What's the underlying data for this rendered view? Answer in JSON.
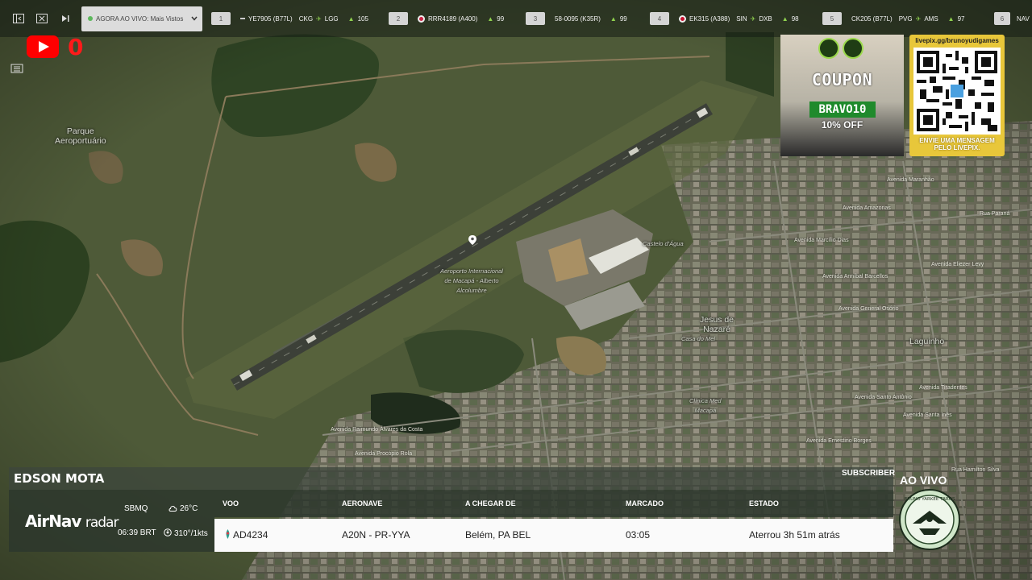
{
  "toolbar": {
    "live_selector": "AGORA AO VIVO: Mais Vistos",
    "flights": [
      {
        "num": "1",
        "callsign": "YE7905 (B77L)",
        "from": "CKG",
        "to": "LGG",
        "pax": "105"
      },
      {
        "num": "2",
        "callsign": "RRR4189 (A400)",
        "from": "",
        "to": "",
        "pax": "99"
      },
      {
        "num": "3",
        "callsign": "58-0095 (K35R)",
        "from": "",
        "to": "",
        "pax": "99"
      },
      {
        "num": "4",
        "callsign": "EK315 (A388)",
        "from": "SIN",
        "to": "DXB",
        "pax": "98"
      },
      {
        "num": "5",
        "callsign": "CK205 (B77L)",
        "from": "PVG",
        "to": "AMS",
        "pax": "97"
      },
      {
        "num": "6",
        "callsign": "NAV",
        "from": "",
        "to": "",
        "pax": ""
      }
    ]
  },
  "overlay": {
    "viewer_count": "0"
  },
  "map": {
    "labels": {
      "park": "Parque\nAeroportuário",
      "airport": "Aeroporto Internacional\nde Macapá - Alberto\nAlcolumbre",
      "water_tower": "Castelo d'Água",
      "nazare": "Jesus de\nNazaré",
      "laguinho": "Laguinho",
      "casa": "Casa do Mel",
      "clinic": "Clínica Med\nMacapá",
      "streets": [
        "Avenida Raimundo Álvares da Costa",
        "Avenida Procópio Rola",
        "Avenida Marcílio Dias",
        "Avenida Anníbal Barcellos",
        "Avenida General Osório",
        "Avenida Santo Antônio",
        "Avenida Ernestino Borges",
        "Avenida Eliezer Levy",
        "Avenida Tiradentes",
        "Rua Paraná",
        "Avenida Maranhão",
        "Avenida Amazonas",
        "Avenida Santa Inês",
        "Rua Hamilton Silva"
      ]
    }
  },
  "ads": {
    "coupon": {
      "brand": "",
      "title": "COUPON",
      "subtitle": "",
      "code": "BRAVO10",
      "discount": "10% OFF",
      "fine": "",
      "footer": ""
    },
    "qr": {
      "url": "livepix.gg/brunoyudigames",
      "message": "ENVIE UMA MENSAGEM\nPELO LIVEPIX."
    }
  },
  "panel": {
    "streamer": "EDSON MOTA",
    "brand_main": "AirNav",
    "brand_sub": "radar",
    "icao": "SBMQ",
    "local_time": "06:39 BRT",
    "temperature": "26°C",
    "wind": "310°/1kts",
    "headers": [
      "VOO",
      "AERONAVE",
      "A CHEGAR DE",
      "MARCADO",
      "ESTADO"
    ],
    "row": {
      "flight": "AD4234",
      "aircraft": "A20N - PR-YYA",
      "from": "Belém, PA BEL",
      "scheduled": "03:05",
      "status": "Aterrou 3h 51m atrás"
    },
    "subscriber": "SUBSCRIBER",
    "live": "AO VIVO",
    "crest_text": "BRUNO YARKEE TAROS"
  },
  "colors": {
    "accent_green": "#8fd14f",
    "youtube_red": "#ff0000",
    "qr_yellow": "#e8c73a"
  }
}
